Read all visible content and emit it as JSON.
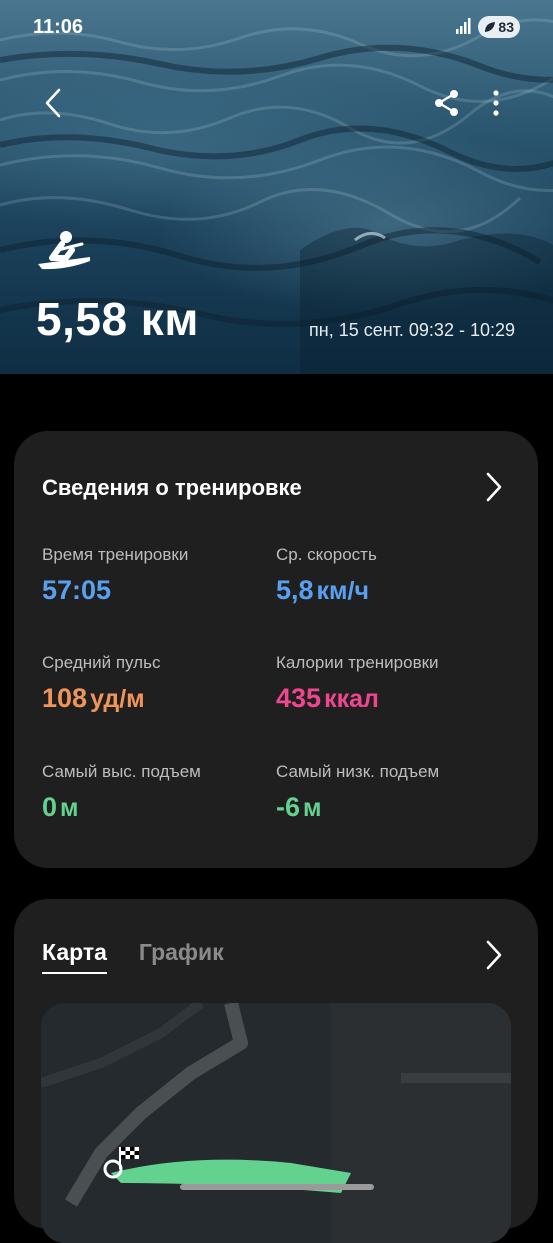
{
  "status": {
    "time": "11:06",
    "battery": "83"
  },
  "hero": {
    "distance": "5,58 км",
    "datetime": "пн, 15 сент. 09:32 - 10:29",
    "activity_icon": "rowing-icon"
  },
  "details": {
    "title": "Сведения о тренировке",
    "stats": [
      {
        "label": "Время тренировки",
        "value": "57:05",
        "unit": "",
        "color": "#5aa0f0"
      },
      {
        "label": "Ср. скорость",
        "value": "5,8",
        "unit": "км/ч",
        "color": "#5aa0f0"
      },
      {
        "label": "Средний пульс",
        "value": "108",
        "unit": "уд/м",
        "color": "#f0955a"
      },
      {
        "label": "Калории тренировки",
        "value": "435",
        "unit": "ккал",
        "color": "#f0468f"
      },
      {
        "label": "Самый выс. подъем",
        "value": "0",
        "unit": "м",
        "color": "#62d28e"
      },
      {
        "label": "Самый низк. подъем",
        "value": "-6",
        "unit": "м",
        "color": "#62d28e"
      }
    ]
  },
  "map_card": {
    "tabs": [
      {
        "label": "Карта",
        "active": true
      },
      {
        "label": "График",
        "active": false
      }
    ]
  }
}
